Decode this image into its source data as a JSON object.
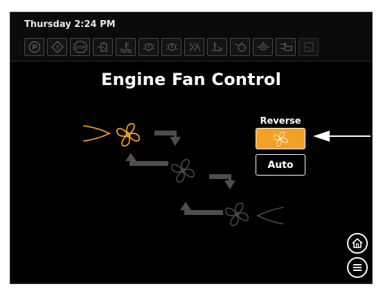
{
  "status_bar": {
    "datetime": "Thursday 2:24 PM",
    "indicators": [
      {
        "icon": "parking-brake-icon",
        "label": "P"
      },
      {
        "icon": "warning-icon",
        "label": "!"
      },
      {
        "icon": "stop-icon",
        "label": "STOP"
      },
      {
        "icon": "fuel-filter-icon"
      },
      {
        "icon": "coolant-temperature-icon"
      },
      {
        "icon": "transmission-warning-icon"
      },
      {
        "icon": "transmission-temperature-icon"
      },
      {
        "icon": "transmission-filter-icon"
      },
      {
        "icon": "hydraulic-temperature-icon"
      },
      {
        "icon": "engine-oil-pressure-icon"
      },
      {
        "icon": "engine-check-icon"
      },
      {
        "icon": "air-filter-icon"
      },
      {
        "icon": "water-in-fuel-icon"
      }
    ]
  },
  "title": "Engine Fan Control",
  "controls": {
    "reverse_label": "Reverse",
    "reverse_icon": "fan-icon",
    "auto_label": "Auto"
  },
  "nav": {
    "home_icon": "home-icon",
    "menu_icon": "menu-icon"
  },
  "colors": {
    "active": "#f3a126",
    "inactive": "#4a4a4a",
    "background": "#000000",
    "text": "#ffffff"
  }
}
